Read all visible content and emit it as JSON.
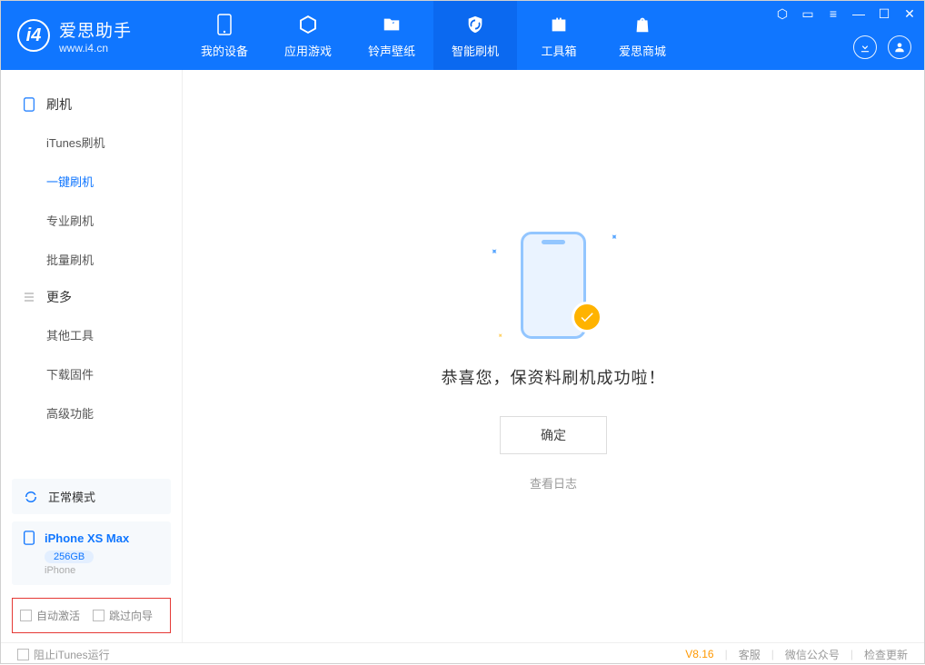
{
  "app": {
    "name_cn": "爱思助手",
    "name_en": "www.i4.cn"
  },
  "tabs": {
    "device": "我的设备",
    "apps": "应用游戏",
    "rings": "铃声壁纸",
    "flash": "智能刷机",
    "tools": "工具箱",
    "store": "爱思商城"
  },
  "sidebar": {
    "group_flash": "刷机",
    "items_flash": {
      "itunes": "iTunes刷机",
      "onekey": "一键刷机",
      "pro": "专业刷机",
      "batch": "批量刷机"
    },
    "group_more": "更多",
    "items_more": {
      "other": "其他工具",
      "firmware": "下载固件",
      "advanced": "高级功能"
    },
    "status_mode": "正常模式",
    "device": {
      "name": "iPhone XS Max",
      "capacity": "256GB",
      "type": "iPhone"
    },
    "chk_auto_activate": "自动激活",
    "chk_skip_guide": "跳过向导"
  },
  "main": {
    "success_msg": "恭喜您，保资料刷机成功啦！",
    "ok_btn": "确定",
    "view_log": "查看日志"
  },
  "footer": {
    "block_itunes": "阻止iTunes运行",
    "version": "V8.16",
    "kefu": "客服",
    "wechat": "微信公众号",
    "update": "检查更新"
  }
}
